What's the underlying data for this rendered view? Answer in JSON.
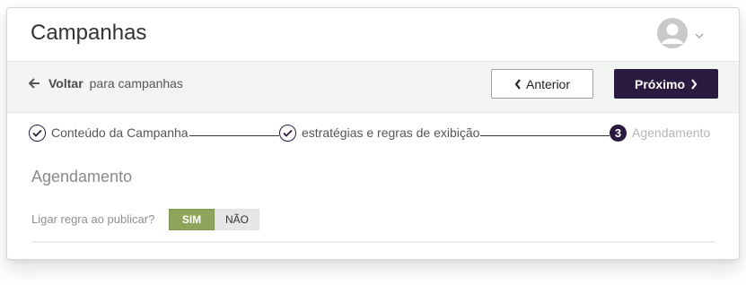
{
  "header": {
    "title": "Campanhas",
    "avatar_icon": "user-avatar-icon",
    "caret_icon": "chevron-down-icon"
  },
  "toolbar": {
    "back_strong": "Voltar",
    "back_rest": "para campanhas",
    "prev_label": "Anterior",
    "next_label": "Próximo"
  },
  "steps": [
    {
      "label": "Conteúdo da Campanha",
      "state": "done"
    },
    {
      "label": "estratégias e regras de exibição",
      "state": "done"
    },
    {
      "number": "3",
      "label": "Agendamento",
      "state": "current"
    }
  ],
  "section": {
    "title": "Agendamento",
    "field_label": "Ligar regra ao publicar?",
    "toggle_yes": "SIM",
    "toggle_no": "NÃO",
    "selected": "SIM"
  },
  "colors": {
    "primary": "#2a1a3f",
    "toggle_on": "#8ea55b",
    "toolbar_bg": "#f3f5f3"
  }
}
